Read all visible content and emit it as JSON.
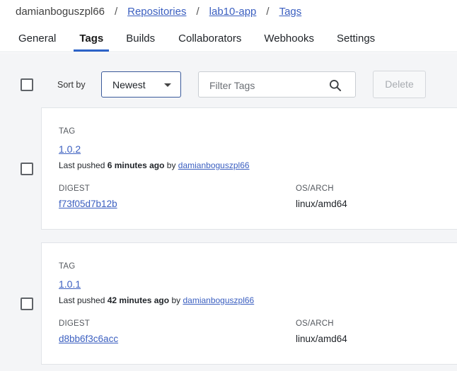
{
  "breadcrumb": {
    "user": "damianboguszpl66",
    "separator": "/",
    "items": [
      "Repositories",
      "lab10-app",
      "Tags"
    ]
  },
  "tabs": [
    {
      "label": "General",
      "active": false
    },
    {
      "label": "Tags",
      "active": true
    },
    {
      "label": "Builds",
      "active": false
    },
    {
      "label": "Collaborators",
      "active": false
    },
    {
      "label": "Webhooks",
      "active": false
    },
    {
      "label": "Settings",
      "active": false
    }
  ],
  "toolbar": {
    "sort_label": "Sort by",
    "sort_value": "Newest",
    "filter_placeholder": "Filter Tags",
    "delete_label": "Delete"
  },
  "icons": {
    "search": "search-icon",
    "dropdown": "chevron-down-icon"
  },
  "colors": {
    "link": "#3b5fc0",
    "tab_indicator": "#2d63c8",
    "background": "#f4f5f7"
  },
  "tags": [
    {
      "tag_label": "TAG",
      "name": "1.0.2",
      "pushed_prefix": "Last pushed",
      "pushed_time": "6 minutes ago",
      "pushed_by": "by",
      "user": "damianboguszpl66",
      "digest_label": "DIGEST",
      "digest": "f73f05d7b12b",
      "arch_label": "OS/ARCH",
      "arch": "linux/amd64"
    },
    {
      "tag_label": "TAG",
      "name": "1.0.1",
      "pushed_prefix": "Last pushed",
      "pushed_time": "42 minutes ago",
      "pushed_by": "by",
      "user": "damianboguszpl66",
      "digest_label": "DIGEST",
      "digest": "d8bb6f3c6acc",
      "arch_label": "OS/ARCH",
      "arch": "linux/amd64"
    }
  ]
}
